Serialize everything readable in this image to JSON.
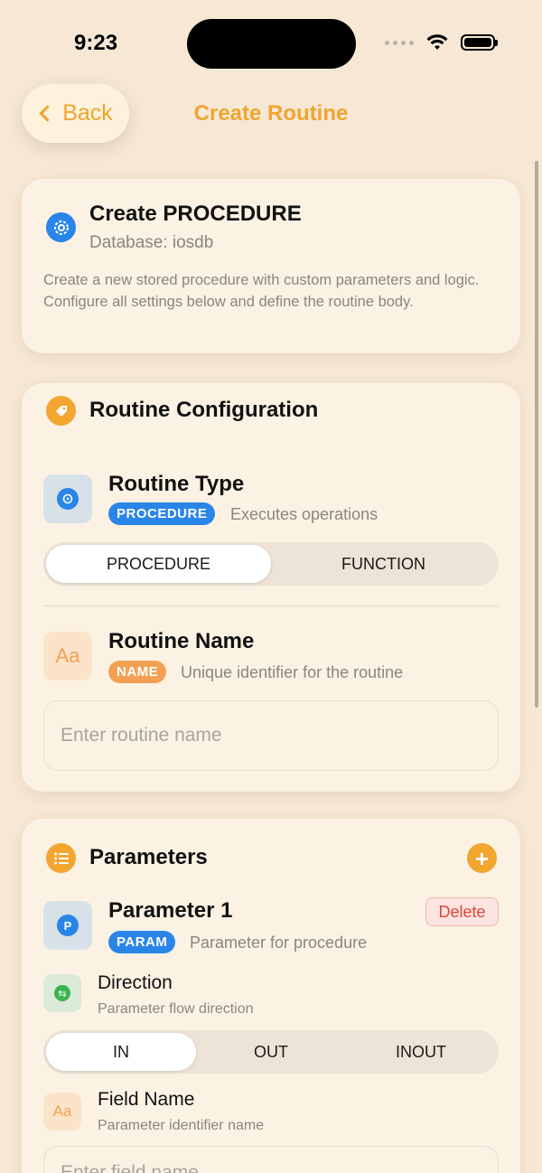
{
  "status": {
    "time": "9:23"
  },
  "nav": {
    "back_label": "Back",
    "title": "Create Routine"
  },
  "header_card": {
    "title": "Create PROCEDURE",
    "subtitle": "Database: iosdb",
    "description": "Create a new stored procedure with custom parameters and logic. Configure all settings below and define the routine body."
  },
  "config": {
    "section_title": "Routine Configuration",
    "routine_type": {
      "title": "Routine Type",
      "badge": "PROCEDURE",
      "hint": "Executes operations",
      "options": [
        "PROCEDURE",
        "FUNCTION"
      ],
      "selected": "PROCEDURE"
    },
    "routine_name": {
      "title": "Routine Name",
      "badge": "NAME",
      "hint": "Unique identifier for the routine",
      "placeholder": "Enter routine name",
      "icon_text": "Aa"
    }
  },
  "parameters": {
    "section_title": "Parameters",
    "param": {
      "title": "Parameter 1",
      "badge": "PARAM",
      "hint": "Parameter for procedure",
      "icon_letter": "P",
      "delete_label": "Delete",
      "direction": {
        "title": "Direction",
        "hint": "Parameter flow direction",
        "options": [
          "IN",
          "OUT",
          "INOUT"
        ],
        "selected": "IN"
      },
      "field_name": {
        "title": "Field Name",
        "hint": "Parameter identifier name",
        "placeholder": "Enter field name",
        "icon_text": "Aa"
      }
    }
  },
  "colors": {
    "accent": "#f0a531",
    "blue": "#2a85e8",
    "background": "#f6e8d5",
    "danger": "#e0443e"
  }
}
